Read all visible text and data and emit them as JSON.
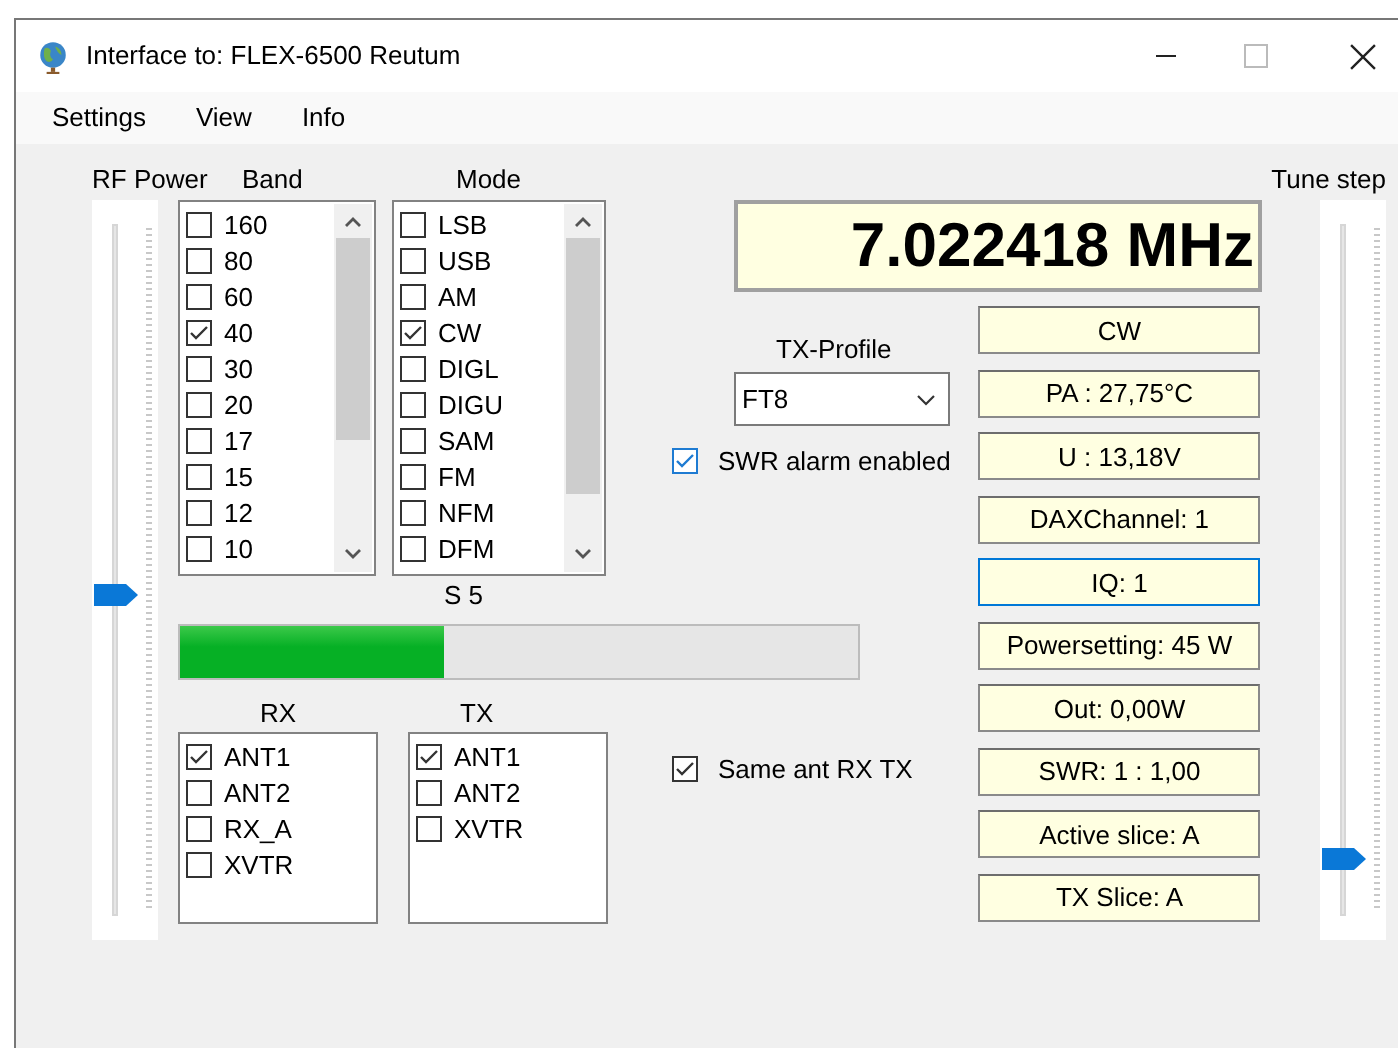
{
  "window": {
    "title": "Interface to: FLEX-6500 Reutum"
  },
  "menu": [
    "Settings",
    "View",
    "Info"
  ],
  "rf_power": {
    "label": "RF Power",
    "level": 0.45
  },
  "band": {
    "label": "Band",
    "items": [
      {
        "label": "160",
        "checked": false
      },
      {
        "label": "80",
        "checked": false
      },
      {
        "label": "60",
        "checked": false
      },
      {
        "label": "40",
        "checked": true
      },
      {
        "label": "30",
        "checked": false
      },
      {
        "label": "20",
        "checked": false
      },
      {
        "label": "17",
        "checked": false
      },
      {
        "label": "15",
        "checked": false
      },
      {
        "label": "12",
        "checked": false
      },
      {
        "label": "10",
        "checked": false
      }
    ]
  },
  "mode": {
    "label": "Mode",
    "items": [
      {
        "label": "LSB",
        "checked": false
      },
      {
        "label": "USB",
        "checked": false
      },
      {
        "label": "AM",
        "checked": false
      },
      {
        "label": "CW",
        "checked": true
      },
      {
        "label": "DIGL",
        "checked": false
      },
      {
        "label": "DIGU",
        "checked": false
      },
      {
        "label": "SAM",
        "checked": false
      },
      {
        "label": "FM",
        "checked": false
      },
      {
        "label": "NFM",
        "checked": false
      },
      {
        "label": "DFM",
        "checked": false
      }
    ]
  },
  "s_meter": {
    "label": "S 5",
    "level": 0.39
  },
  "rx": {
    "label": "RX",
    "items": [
      {
        "label": "ANT1",
        "checked": true
      },
      {
        "label": "ANT2",
        "checked": false
      },
      {
        "label": "RX_A",
        "checked": false
      },
      {
        "label": "XVTR",
        "checked": false
      }
    ]
  },
  "tx": {
    "label": "TX",
    "items": [
      {
        "label": "ANT1",
        "checked": true
      },
      {
        "label": "ANT2",
        "checked": false
      },
      {
        "label": "XVTR",
        "checked": false
      }
    ]
  },
  "frequency": "7.022418 MHz",
  "tx_profile": {
    "label": "TX-Profile",
    "value": "FT8"
  },
  "swr_alarm": {
    "label": "SWR alarm enabled",
    "checked": true
  },
  "same_ant": {
    "label": "Same ant RX TX",
    "checked": true
  },
  "status_fields": [
    {
      "text": "CW",
      "focused": false
    },
    {
      "text": "PA  : 27,75°C",
      "focused": false
    },
    {
      "text": "U  : 13,18V",
      "focused": false
    },
    {
      "text": "DAXChannel: 1",
      "focused": false
    },
    {
      "text": "IQ: 1",
      "focused": true
    },
    {
      "text": "Powersetting: 45 W",
      "focused": false
    },
    {
      "text": "Out: 0,00W",
      "focused": false
    },
    {
      "text": "SWR: 1 : 1,00",
      "focused": false
    },
    {
      "text": "Active slice: A",
      "focused": false
    },
    {
      "text": "TX Slice: A",
      "focused": false
    }
  ],
  "tune_step": {
    "label": "Tune step",
    "level": 0.06
  }
}
